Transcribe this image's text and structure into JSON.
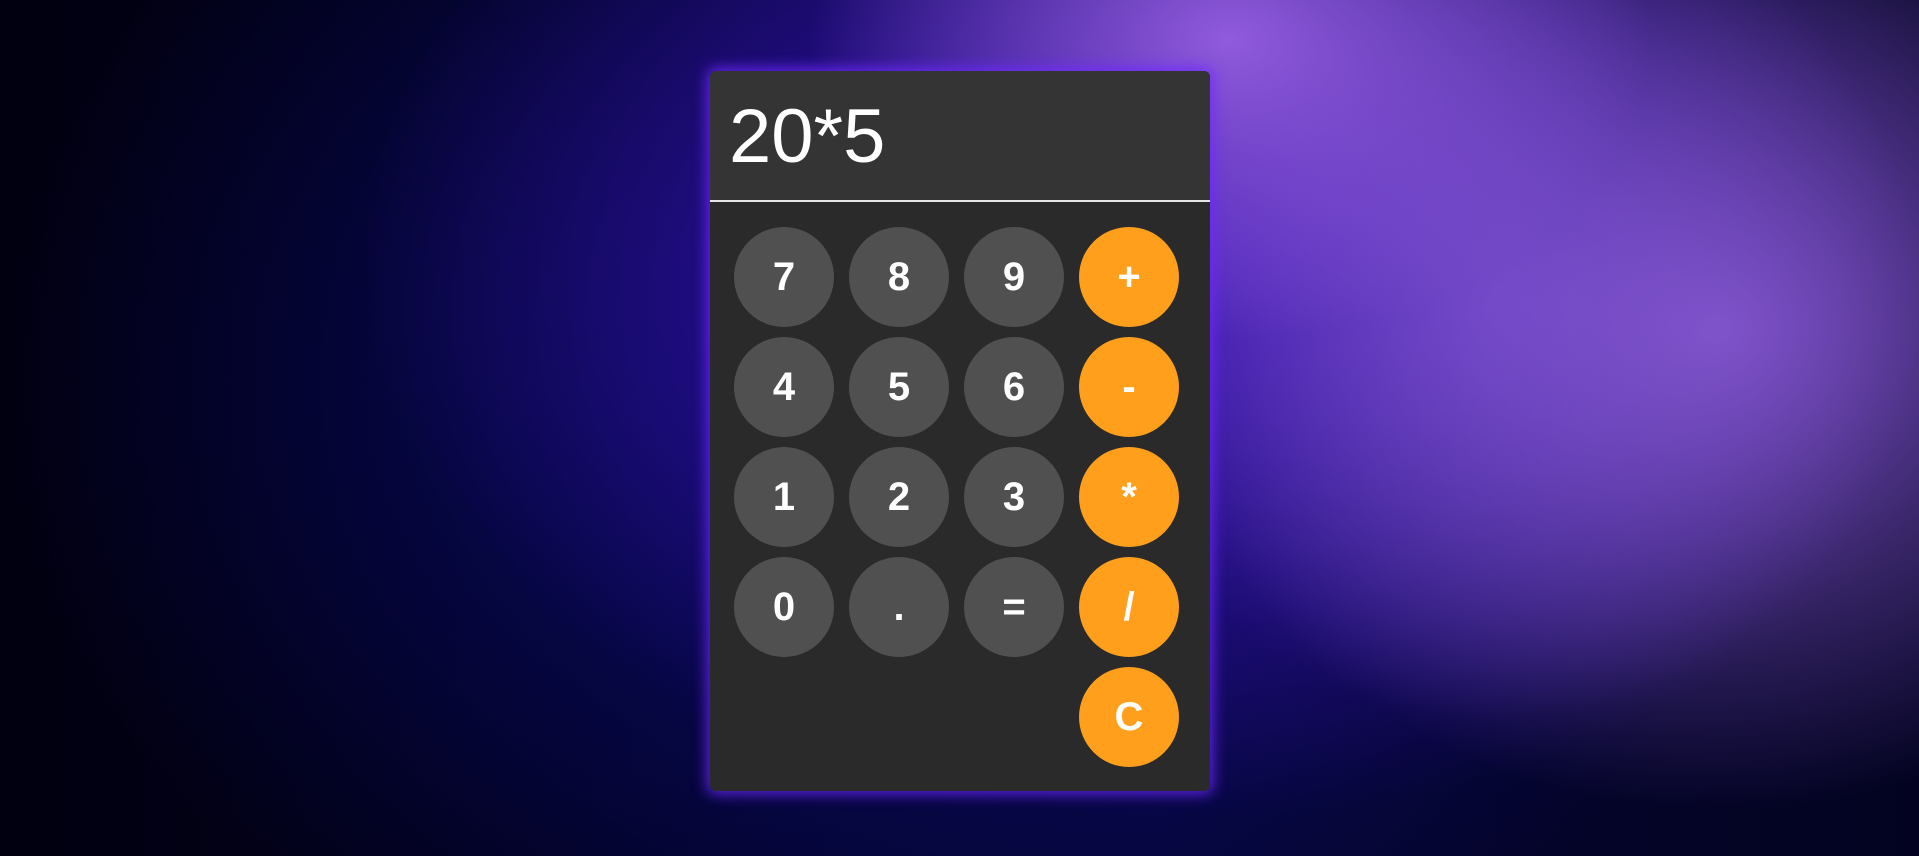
{
  "calculator": {
    "display": {
      "value": "20*5"
    },
    "keys": {
      "k7": "7",
      "k8": "8",
      "k9": "9",
      "plus": "+",
      "k4": "4",
      "k5": "5",
      "k6": "6",
      "minus": "-",
      "k1": "1",
      "k2": "2",
      "k3": "3",
      "multiply": "*",
      "k0": "0",
      "dot": ".",
      "equals": "=",
      "divide": "/",
      "clear": "C"
    },
    "colors": {
      "number_key": "#505050",
      "operator_key": "#ff9f1c",
      "panel": "#2a2a2a",
      "display": "#343434",
      "glow": "#6e28ff"
    }
  }
}
